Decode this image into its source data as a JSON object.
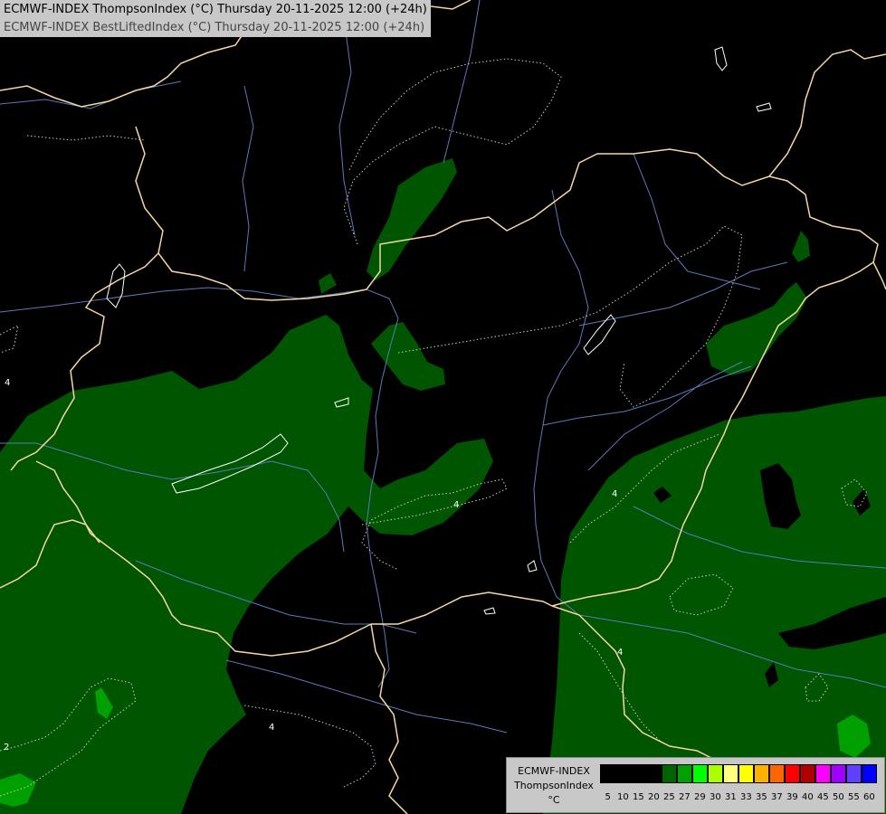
{
  "header": {
    "line1": "ECMWF-INDEX ThompsonIndex (°C) Thursday 20-11-2025 12:00 (+24h)",
    "line2": "ECMWF-INDEX BestLiftedIndex (°C) Thursday 20-11-2025 12:00 (+24h)"
  },
  "contour_labels": [
    "4",
    "4",
    "4",
    "4",
    "4",
    "2"
  ],
  "legend": {
    "model": "ECMWF-INDEX",
    "parameter": "ThompsonIndex",
    "unit": "°C",
    "colors": [
      "#000000",
      "#000000",
      "#000000",
      "#000000",
      "#006400",
      "#00a000",
      "#00ff00",
      "#aaff00",
      "#ffff80",
      "#ffff00",
      "#ffb000",
      "#ff6600",
      "#ff0000",
      "#b00000",
      "#ff00ff",
      "#a000ff",
      "#6040ff",
      "#0000ff"
    ],
    "ticks": [
      "5",
      "10",
      "15",
      "20",
      "25",
      "27",
      "29",
      "30",
      "31",
      "33",
      "35",
      "37",
      "39",
      "40",
      "45",
      "50",
      "55",
      "60"
    ]
  },
  "colors": {
    "background": "#000000",
    "dark_green": "#005500",
    "mid_green": "#00a000",
    "borders": "#f5d7a3",
    "rivers": "#5a7ab8"
  }
}
